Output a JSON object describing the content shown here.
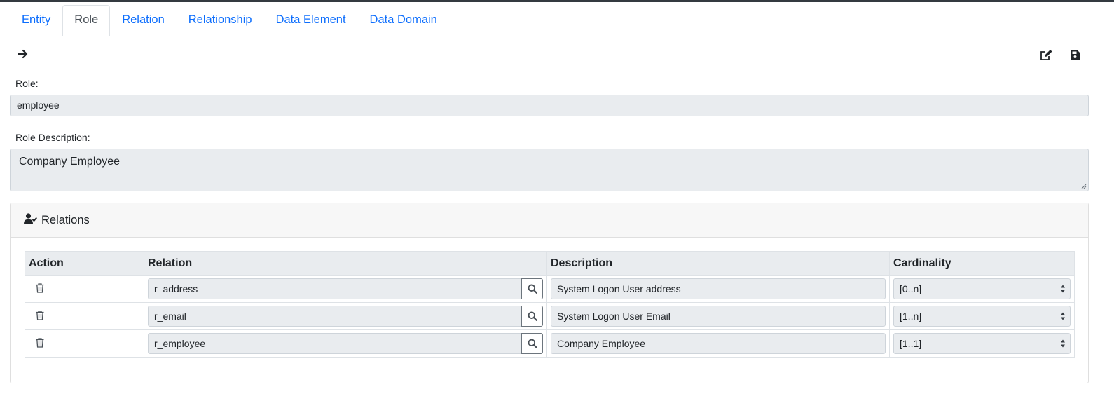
{
  "tabs": [
    {
      "label": "Entity",
      "active": false
    },
    {
      "label": "Role",
      "active": true
    },
    {
      "label": "Relation",
      "active": false
    },
    {
      "label": "Relationship",
      "active": false
    },
    {
      "label": "Data Element",
      "active": false
    },
    {
      "label": "Data Domain",
      "active": false
    }
  ],
  "toolbar": {
    "back_icon": "arrow-right-icon",
    "edit_icon": "edit-icon",
    "save_icon": "save-icon"
  },
  "form": {
    "role_label": "Role:",
    "role_value": "employee",
    "description_label": "Role Description:",
    "description_value": "Company Employee"
  },
  "relations": {
    "title": "Relations",
    "icon": "user-check-icon",
    "headers": {
      "action": "Action",
      "relation": "Relation",
      "description": "Description",
      "cardinality": "Cardinality"
    },
    "rows": [
      {
        "relation": "r_address",
        "description": "System Logon User address",
        "cardinality": "[0..n]"
      },
      {
        "relation": "r_email",
        "description": "System Logon User Email",
        "cardinality": "[1..n]"
      },
      {
        "relation": "r_employee",
        "description": "Company Employee",
        "cardinality": "[1..1]"
      }
    ]
  },
  "colors": {
    "link": "#0d6efd",
    "readonly_bg": "#e9ecef",
    "header_bg": "#f7f7f7",
    "top_bar": "#343a40"
  }
}
